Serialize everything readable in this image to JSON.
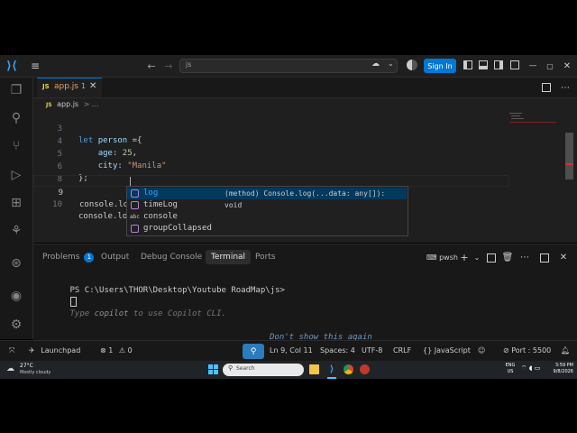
{
  "titlebar": {
    "search_text": "js",
    "signin_label": "Sign In"
  },
  "tabbar": {
    "file_badge": "JS",
    "file_name": "app.js",
    "file_modified": "1"
  },
  "breadcrumb": {
    "badge": "JS",
    "file": "app.js",
    "sep": "> ..."
  },
  "editor": {
    "lines": [
      {
        "n": "3",
        "code": "let person ={"
      },
      {
        "n": "4",
        "code": "    age: 25,"
      },
      {
        "n": "5",
        "code": "    city: \"Manila\""
      },
      {
        "n": "6",
        "code": "};"
      },
      {
        "n": "8",
        "code": ""
      },
      {
        "n": "9",
        "code": "console.log"
      },
      {
        "n": "10",
        "code": "console.lo"
      }
    ]
  },
  "autocomplete": {
    "items": [
      {
        "kind": "method",
        "label": "log",
        "detail": "(method) Console.log(...data: any[]): void",
        "selected": true
      },
      {
        "kind": "method",
        "label": "timeLog",
        "detail": "",
        "selected": false
      },
      {
        "kind": "text",
        "label": "console",
        "detail": "",
        "selected": false
      },
      {
        "kind": "method",
        "label": "groupCollapsed",
        "detail": "",
        "selected": false
      }
    ],
    "text_kind_label": "abc"
  },
  "panel": {
    "tabs": [
      {
        "label": "Problems",
        "badge": "1"
      },
      {
        "label": "Output"
      },
      {
        "label": "Debug Console"
      },
      {
        "label": "Terminal",
        "active": true
      },
      {
        "label": "Ports"
      }
    ],
    "shell_name": "pwsh",
    "prompt": "PS C:\\Users\\THOR\\Desktop\\Youtube RoadMap\\js>",
    "hint_part1": "Type ",
    "hint_copilot": "copilot",
    "hint_part2": " to use Copilot CLI.",
    "dont_show": "Don't show this again"
  },
  "statusbar": {
    "launchpad": "Launchpad",
    "errors": "1",
    "warnings": "0",
    "position": "Ln 9, Col 11",
    "spaces": "Spaces: 4",
    "encoding": "UTF-8",
    "eol": "CRLF",
    "language": "JavaScript",
    "port": "Port : 5500"
  },
  "taskbar": {
    "temp": "27°C",
    "weather": "Mostly cloudy",
    "search": "Search",
    "lang1": "ENG",
    "lang2": "US",
    "time": "3:59 PM",
    "date": "9/8/2026"
  },
  "colors": {
    "accent": "#0078d4",
    "terminal_hint": "#6f9ac2",
    "selection": "#04395e"
  }
}
